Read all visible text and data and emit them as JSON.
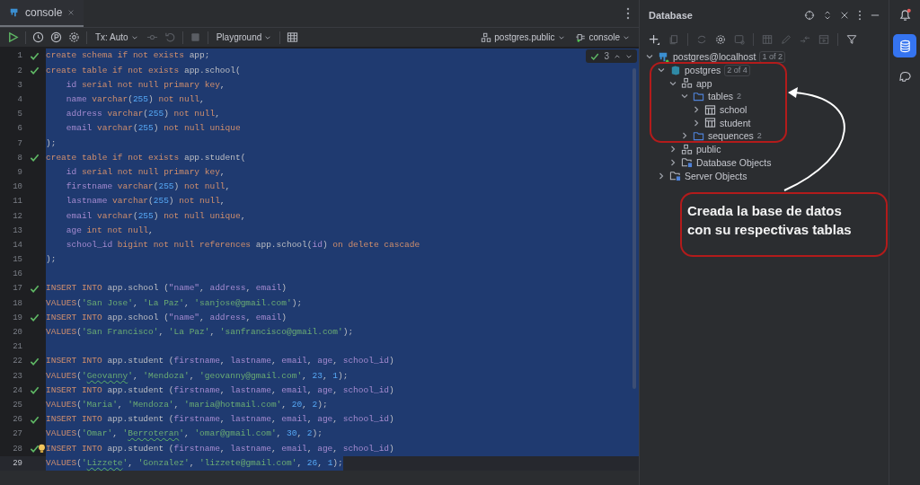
{
  "editor_tab": {
    "label": "console",
    "selected": true
  },
  "toolbar": {
    "tx_mode": "Tx: Auto",
    "session_mode": "Playground",
    "schema": "postgres.public",
    "session": "console"
  },
  "inspection": {
    "count": "3"
  },
  "code_lines": [
    {
      "number": "1",
      "checked": true,
      "selected": true,
      "tokens": [
        {
          "kind": "kw",
          "text": "create schema if not exists "
        },
        {
          "kind": "ident",
          "text": "app;"
        }
      ]
    },
    {
      "number": "2",
      "checked": true,
      "selected": true,
      "tokens": [
        {
          "kind": "kw",
          "text": "create table if not exists "
        },
        {
          "kind": "ident",
          "text": "app.school("
        }
      ]
    },
    {
      "number": "3",
      "checked": false,
      "selected": true,
      "tokens": [
        {
          "kind": "field",
          "text": "    id"
        },
        {
          "kind": "kw",
          "text": " serial not null primary key"
        },
        {
          "kind": "punct",
          "text": ","
        }
      ]
    },
    {
      "number": "4",
      "checked": false,
      "selected": true,
      "tokens": [
        {
          "kind": "field",
          "text": "    name"
        },
        {
          "kind": "kw",
          "text": " varchar"
        },
        {
          "kind": "punct",
          "text": "("
        },
        {
          "kind": "num",
          "text": "255"
        },
        {
          "kind": "punct",
          "text": ")"
        },
        {
          "kind": "kw",
          "text": " not null"
        },
        {
          "kind": "punct",
          "text": ","
        }
      ]
    },
    {
      "number": "5",
      "checked": false,
      "selected": true,
      "tokens": [
        {
          "kind": "field",
          "text": "    address"
        },
        {
          "kind": "kw",
          "text": " varchar"
        },
        {
          "kind": "punct",
          "text": "("
        },
        {
          "kind": "num",
          "text": "255"
        },
        {
          "kind": "punct",
          "text": ")"
        },
        {
          "kind": "kw",
          "text": " not null"
        },
        {
          "kind": "punct",
          "text": ","
        }
      ]
    },
    {
      "number": "6",
      "checked": false,
      "selected": true,
      "tokens": [
        {
          "kind": "field",
          "text": "    email"
        },
        {
          "kind": "kw",
          "text": " varchar"
        },
        {
          "kind": "punct",
          "text": "("
        },
        {
          "kind": "num",
          "text": "255"
        },
        {
          "kind": "punct",
          "text": ")"
        },
        {
          "kind": "kw",
          "text": " not null unique"
        }
      ]
    },
    {
      "number": "7",
      "checked": false,
      "selected": true,
      "tokens": [
        {
          "kind": "punct",
          "text": ");"
        }
      ]
    },
    {
      "number": "8",
      "checked": true,
      "selected": true,
      "tokens": [
        {
          "kind": "kw",
          "text": "create table if not exists "
        },
        {
          "kind": "ident",
          "text": "app.student("
        }
      ]
    },
    {
      "number": "9",
      "checked": false,
      "selected": true,
      "tokens": [
        {
          "kind": "field",
          "text": "    id"
        },
        {
          "kind": "kw",
          "text": " serial not null primary key"
        },
        {
          "kind": "punct",
          "text": ","
        }
      ]
    },
    {
      "number": "10",
      "checked": false,
      "selected": true,
      "tokens": [
        {
          "kind": "field",
          "text": "    firstname"
        },
        {
          "kind": "kw",
          "text": " varchar"
        },
        {
          "kind": "punct",
          "text": "("
        },
        {
          "kind": "num",
          "text": "255"
        },
        {
          "kind": "punct",
          "text": ")"
        },
        {
          "kind": "kw",
          "text": " not null"
        },
        {
          "kind": "punct",
          "text": ","
        }
      ]
    },
    {
      "number": "11",
      "checked": false,
      "selected": true,
      "tokens": [
        {
          "kind": "field",
          "text": "    lastname"
        },
        {
          "kind": "kw",
          "text": " varchar"
        },
        {
          "kind": "punct",
          "text": "("
        },
        {
          "kind": "num",
          "text": "255"
        },
        {
          "kind": "punct",
          "text": ")"
        },
        {
          "kind": "kw",
          "text": " not null"
        },
        {
          "kind": "punct",
          "text": ","
        }
      ]
    },
    {
      "number": "12",
      "checked": false,
      "selected": true,
      "tokens": [
        {
          "kind": "field",
          "text": "    email"
        },
        {
          "kind": "kw",
          "text": " varchar"
        },
        {
          "kind": "punct",
          "text": "("
        },
        {
          "kind": "num",
          "text": "255"
        },
        {
          "kind": "punct",
          "text": ")"
        },
        {
          "kind": "kw",
          "text": " not null unique"
        },
        {
          "kind": "punct",
          "text": ","
        }
      ]
    },
    {
      "number": "13",
      "checked": false,
      "selected": true,
      "tokens": [
        {
          "kind": "field",
          "text": "    age"
        },
        {
          "kind": "kw",
          "text": " int not null"
        },
        {
          "kind": "punct",
          "text": ","
        }
      ]
    },
    {
      "number": "14",
      "checked": false,
      "selected": true,
      "tokens": [
        {
          "kind": "field",
          "text": "    school_id"
        },
        {
          "kind": "kw",
          "text": " bigint not null references "
        },
        {
          "kind": "ident",
          "text": "app.school"
        },
        {
          "kind": "punct",
          "text": "("
        },
        {
          "kind": "field",
          "text": "id"
        },
        {
          "kind": "punct",
          "text": ")"
        },
        {
          "kind": "kw",
          "text": " on delete cascade"
        }
      ]
    },
    {
      "number": "15",
      "checked": false,
      "selected": true,
      "tokens": [
        {
          "kind": "punct",
          "text": ");"
        }
      ]
    },
    {
      "number": "16",
      "checked": false,
      "selected": true
    },
    {
      "number": "17",
      "checked": true,
      "selected": true,
      "tokens": [
        {
          "kind": "kw",
          "text": "INSERT INTO "
        },
        {
          "kind": "ident",
          "text": "app.school ("
        },
        {
          "kind": "field",
          "text": "\"name\""
        },
        {
          "kind": "punct",
          "text": ", "
        },
        {
          "kind": "field",
          "text": "address"
        },
        {
          "kind": "punct",
          "text": ", "
        },
        {
          "kind": "field",
          "text": "email"
        },
        {
          "kind": "punct",
          "text": ")"
        }
      ]
    },
    {
      "number": "18",
      "checked": false,
      "selected": true,
      "tokens": [
        {
          "kind": "kw",
          "text": "VALUES"
        },
        {
          "kind": "punct",
          "text": "("
        },
        {
          "kind": "str",
          "text": "'San Jose'"
        },
        {
          "kind": "punct",
          "text": ", "
        },
        {
          "kind": "str",
          "text": "'La Paz'"
        },
        {
          "kind": "punct",
          "text": ", "
        },
        {
          "kind": "str",
          "text": "'sanjose@gmail.com'"
        },
        {
          "kind": "punct",
          "text": ");"
        }
      ]
    },
    {
      "number": "19",
      "checked": true,
      "selected": true,
      "tokens": [
        {
          "kind": "kw",
          "text": "INSERT INTO "
        },
        {
          "kind": "ident",
          "text": "app.school ("
        },
        {
          "kind": "field",
          "text": "\"name\""
        },
        {
          "kind": "punct",
          "text": ", "
        },
        {
          "kind": "field",
          "text": "address"
        },
        {
          "kind": "punct",
          "text": ", "
        },
        {
          "kind": "field",
          "text": "email"
        },
        {
          "kind": "punct",
          "text": ")"
        }
      ]
    },
    {
      "number": "20",
      "checked": false,
      "selected": true,
      "tokens": [
        {
          "kind": "kw",
          "text": "VALUES"
        },
        {
          "kind": "punct",
          "text": "("
        },
        {
          "kind": "str",
          "text": "'San Francisco'"
        },
        {
          "kind": "punct",
          "text": ", "
        },
        {
          "kind": "str",
          "text": "'La Paz'"
        },
        {
          "kind": "punct",
          "text": ", "
        },
        {
          "kind": "str",
          "text": "'sanfrancisco@gmail.com'"
        },
        {
          "kind": "punct",
          "text": ");"
        }
      ]
    },
    {
      "number": "21",
      "checked": false,
      "selected": true
    },
    {
      "number": "22",
      "checked": true,
      "selected": true,
      "tokens": [
        {
          "kind": "kw",
          "text": "INSERT INTO "
        },
        {
          "kind": "ident",
          "text": "app.student ("
        },
        {
          "kind": "field",
          "text": "firstname"
        },
        {
          "kind": "punct",
          "text": ", "
        },
        {
          "kind": "field",
          "text": "lastname"
        },
        {
          "kind": "punct",
          "text": ", "
        },
        {
          "kind": "field",
          "text": "email"
        },
        {
          "kind": "punct",
          "text": ", "
        },
        {
          "kind": "field",
          "text": "age"
        },
        {
          "kind": "punct",
          "text": ", "
        },
        {
          "kind": "field",
          "text": "school_id"
        },
        {
          "kind": "punct",
          "text": ")"
        }
      ]
    },
    {
      "number": "23",
      "checked": false,
      "selected": true,
      "tokens": [
        {
          "kind": "kw",
          "text": "VALUES"
        },
        {
          "kind": "punct",
          "text": "("
        },
        {
          "kind": "str",
          "text": "'"
        },
        {
          "kind": "typo",
          "text": "Geovanny"
        },
        {
          "kind": "str",
          "text": "'"
        },
        {
          "kind": "punct",
          "text": ", "
        },
        {
          "kind": "str",
          "text": "'Mendoza'"
        },
        {
          "kind": "punct",
          "text": ", "
        },
        {
          "kind": "str",
          "text": "'geovanny@gmail.com'"
        },
        {
          "kind": "punct",
          "text": ", "
        },
        {
          "kind": "num",
          "text": "23"
        },
        {
          "kind": "punct",
          "text": ", "
        },
        {
          "kind": "num",
          "text": "1"
        },
        {
          "kind": "punct",
          "text": ");"
        }
      ]
    },
    {
      "number": "24",
      "checked": true,
      "selected": true,
      "tokens": [
        {
          "kind": "kw",
          "text": "INSERT INTO "
        },
        {
          "kind": "ident",
          "text": "app.student ("
        },
        {
          "kind": "field",
          "text": "firstname"
        },
        {
          "kind": "punct",
          "text": ", "
        },
        {
          "kind": "field",
          "text": "lastname"
        },
        {
          "kind": "punct",
          "text": ", "
        },
        {
          "kind": "field",
          "text": "email"
        },
        {
          "kind": "punct",
          "text": ", "
        },
        {
          "kind": "field",
          "text": "age"
        },
        {
          "kind": "punct",
          "text": ", "
        },
        {
          "kind": "field",
          "text": "school_id"
        },
        {
          "kind": "punct",
          "text": ")"
        }
      ]
    },
    {
      "number": "25",
      "checked": false,
      "selected": true,
      "tokens": [
        {
          "kind": "kw",
          "text": "VALUES"
        },
        {
          "kind": "punct",
          "text": "("
        },
        {
          "kind": "str",
          "text": "'Maria'"
        },
        {
          "kind": "punct",
          "text": ", "
        },
        {
          "kind": "str",
          "text": "'Mendoza'"
        },
        {
          "kind": "punct",
          "text": ", "
        },
        {
          "kind": "str",
          "text": "'maria@hotmail.com'"
        },
        {
          "kind": "punct",
          "text": ", "
        },
        {
          "kind": "num",
          "text": "20"
        },
        {
          "kind": "punct",
          "text": ", "
        },
        {
          "kind": "num",
          "text": "2"
        },
        {
          "kind": "punct",
          "text": ");"
        }
      ]
    },
    {
      "number": "26",
      "checked": true,
      "selected": true,
      "tokens": [
        {
          "kind": "kw",
          "text": "INSERT INTO "
        },
        {
          "kind": "ident",
          "text": "app.student ("
        },
        {
          "kind": "field",
          "text": "firstname"
        },
        {
          "kind": "punct",
          "text": ", "
        },
        {
          "kind": "field",
          "text": "lastname"
        },
        {
          "kind": "punct",
          "text": ", "
        },
        {
          "kind": "field",
          "text": "email"
        },
        {
          "kind": "punct",
          "text": ", "
        },
        {
          "kind": "field",
          "text": "age"
        },
        {
          "kind": "punct",
          "text": ", "
        },
        {
          "kind": "field",
          "text": "school_id"
        },
        {
          "kind": "punct",
          "text": ")"
        }
      ]
    },
    {
      "number": "27",
      "checked": false,
      "selected": true,
      "tokens": [
        {
          "kind": "kw",
          "text": "VALUES"
        },
        {
          "kind": "punct",
          "text": "("
        },
        {
          "kind": "str",
          "text": "'Omar'"
        },
        {
          "kind": "punct",
          "text": ", "
        },
        {
          "kind": "str",
          "text": "'"
        },
        {
          "kind": "typo",
          "text": "Berroteran"
        },
        {
          "kind": "str",
          "text": "'"
        },
        {
          "kind": "punct",
          "text": ", "
        },
        {
          "kind": "str",
          "text": "'omar@gmail.com'"
        },
        {
          "kind": "punct",
          "text": ", "
        },
        {
          "kind": "num",
          "text": "30"
        },
        {
          "kind": "punct",
          "text": ", "
        },
        {
          "kind": "num",
          "text": "2"
        },
        {
          "kind": "punct",
          "text": ");"
        }
      ]
    },
    {
      "number": "28",
      "checked": true,
      "selected": true,
      "hint": true,
      "tokens": [
        {
          "kind": "kw",
          "text": "INSERT INTO "
        },
        {
          "kind": "ident",
          "text": "app.student ("
        },
        {
          "kind": "field",
          "text": "firstname"
        },
        {
          "kind": "punct",
          "text": ", "
        },
        {
          "kind": "field",
          "text": "lastname"
        },
        {
          "kind": "punct",
          "text": ", "
        },
        {
          "kind": "field",
          "text": "email"
        },
        {
          "kind": "punct",
          "text": ", "
        },
        {
          "kind": "field",
          "text": "age"
        },
        {
          "kind": "punct",
          "text": ", "
        },
        {
          "kind": "field",
          "text": "school_id"
        },
        {
          "kind": "punct",
          "text": ")"
        }
      ]
    },
    {
      "number": "29",
      "checked": false,
      "selected": true,
      "current": true,
      "tokens": [
        {
          "kind": "kw",
          "text": "VALUES"
        },
        {
          "kind": "punct",
          "text": "("
        },
        {
          "kind": "str",
          "text": "'"
        },
        {
          "kind": "typo",
          "text": "Lizzete"
        },
        {
          "kind": "str",
          "text": "'"
        },
        {
          "kind": "punct",
          "text": ", "
        },
        {
          "kind": "str",
          "text": "'Gonzalez'"
        },
        {
          "kind": "punct",
          "text": ", "
        },
        {
          "kind": "str",
          "text": "'lizzete@gmail.com'"
        },
        {
          "kind": "punct",
          "text": ", "
        },
        {
          "kind": "num",
          "text": "26"
        },
        {
          "kind": "punct",
          "text": ", "
        },
        {
          "kind": "num",
          "text": "1"
        },
        {
          "kind": "punct",
          "text": ");"
        }
      ]
    }
  ],
  "database_panel": {
    "title": "Database",
    "tree": [
      {
        "label": "postgres@localhost",
        "kind": "datasource",
        "badge": "1 of 2",
        "expanded": true,
        "children": [
          {
            "label": "postgres",
            "kind": "database",
            "badge": "2 of 4",
            "expanded": true,
            "children": [
              {
                "label": "app",
                "kind": "schema",
                "expanded": true,
                "children": [
                  {
                    "label": "tables",
                    "kind": "folder",
                    "count": "2",
                    "expanded": true,
                    "children": [
                      {
                        "label": "school",
                        "kind": "table",
                        "expanded": false
                      },
                      {
                        "label": "student",
                        "kind": "table",
                        "expanded": false
                      }
                    ]
                  },
                  {
                    "label": "sequences",
                    "kind": "folder",
                    "count": "2",
                    "expanded": false
                  }
                ]
              },
              {
                "label": "public",
                "kind": "schema",
                "expanded": false
              },
              {
                "label": "Database Objects",
                "kind": "objects",
                "expanded": false
              }
            ]
          },
          {
            "label": "Server Objects",
            "kind": "objects",
            "expanded": false
          }
        ]
      }
    ]
  },
  "annotation": {
    "lines": [
      "Creada la base de datos",
      "con su respectivas tablas"
    ]
  }
}
